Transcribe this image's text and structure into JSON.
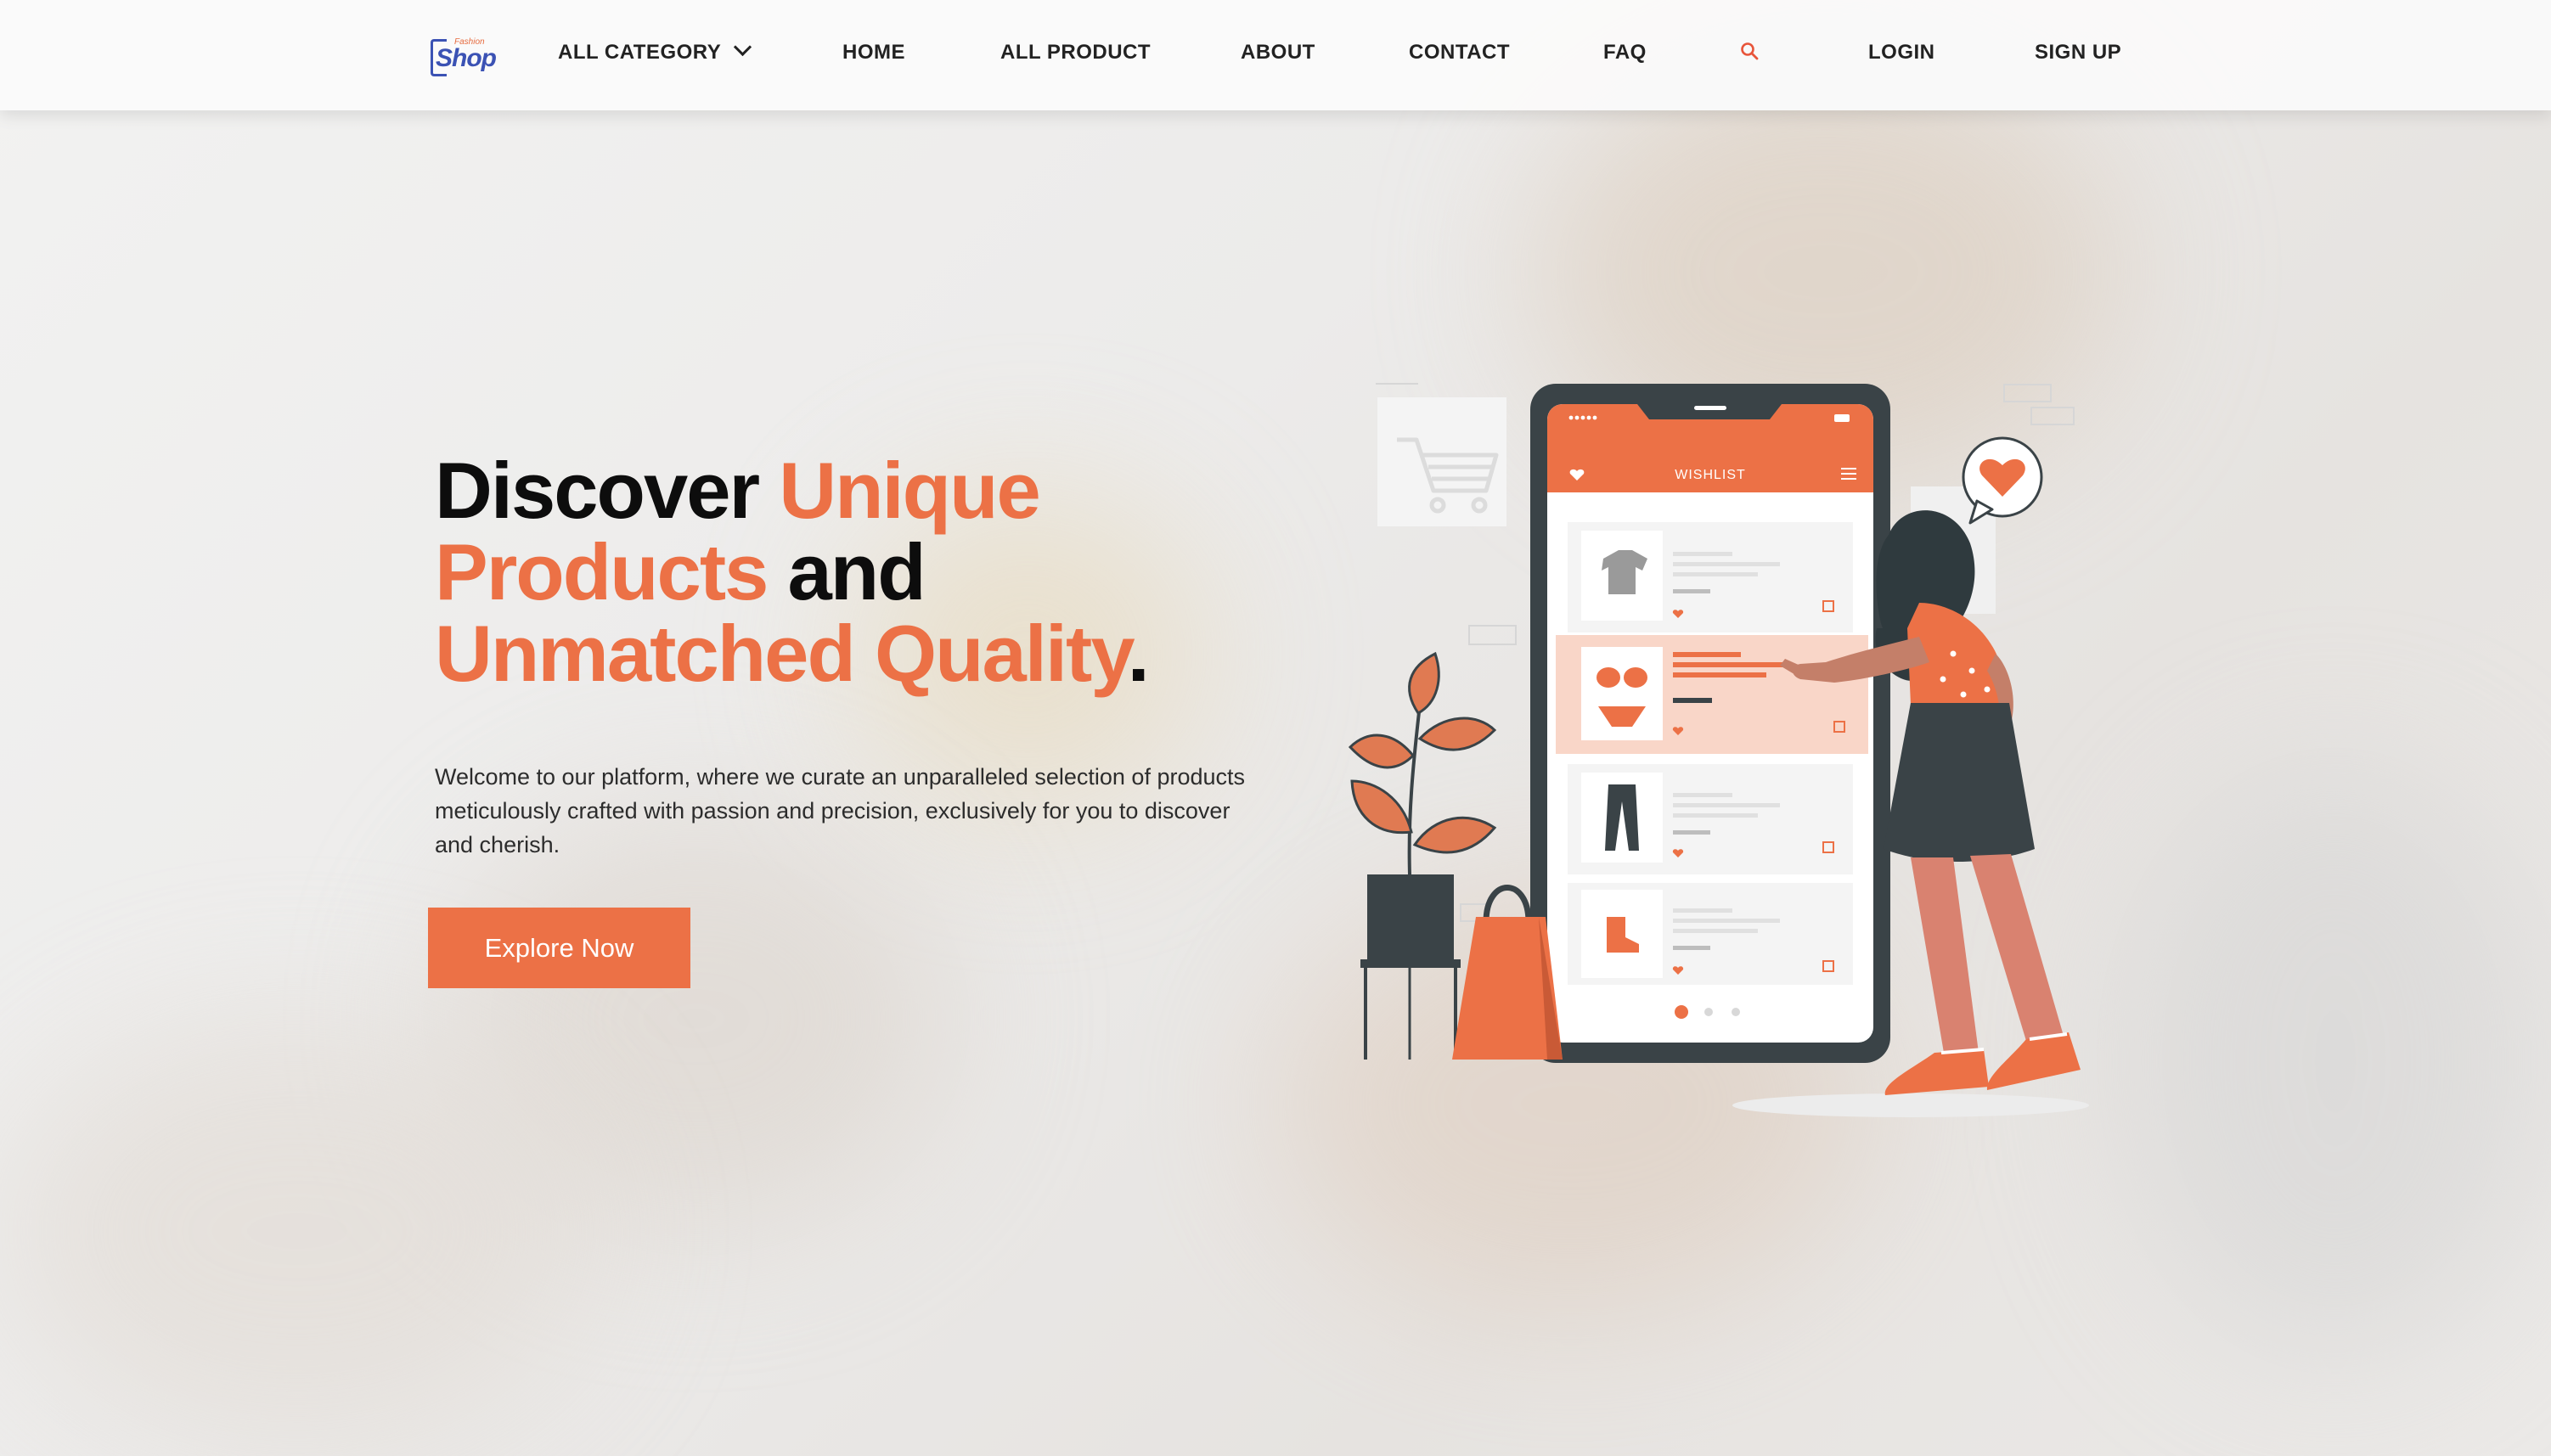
{
  "brand": {
    "logo_small": "Fashion",
    "logo_big": "Shop"
  },
  "nav": {
    "all_category": "ALL CATEGORY",
    "home": "HOME",
    "all_product": "ALL PRODUCT",
    "about": "ABOUT",
    "contact": "CONTACT",
    "faq": "FAQ",
    "login": "LOGIN",
    "signup": "SIGN UP"
  },
  "hero": {
    "headline": {
      "w1": "Discover ",
      "w2": "Unique",
      "w3": "Products",
      "w4": " and",
      "w5": "Unmatched Quality",
      "w6": "."
    },
    "description": "Welcome to our platform, where we curate an unparalleled selection of products meticulously crafted with passion and precision, exclusively for you to discover and cherish.",
    "cta_label": "Explore Now"
  },
  "illustration": {
    "screen_title": "WISHLIST"
  },
  "colors": {
    "accent": "#ec7146",
    "dark": "#3a4347",
    "brand_blue": "#3b52b4"
  },
  "icons": [
    "chevron-down-icon",
    "search-icon",
    "heart-icon",
    "filter-icon",
    "cart-icon"
  ]
}
